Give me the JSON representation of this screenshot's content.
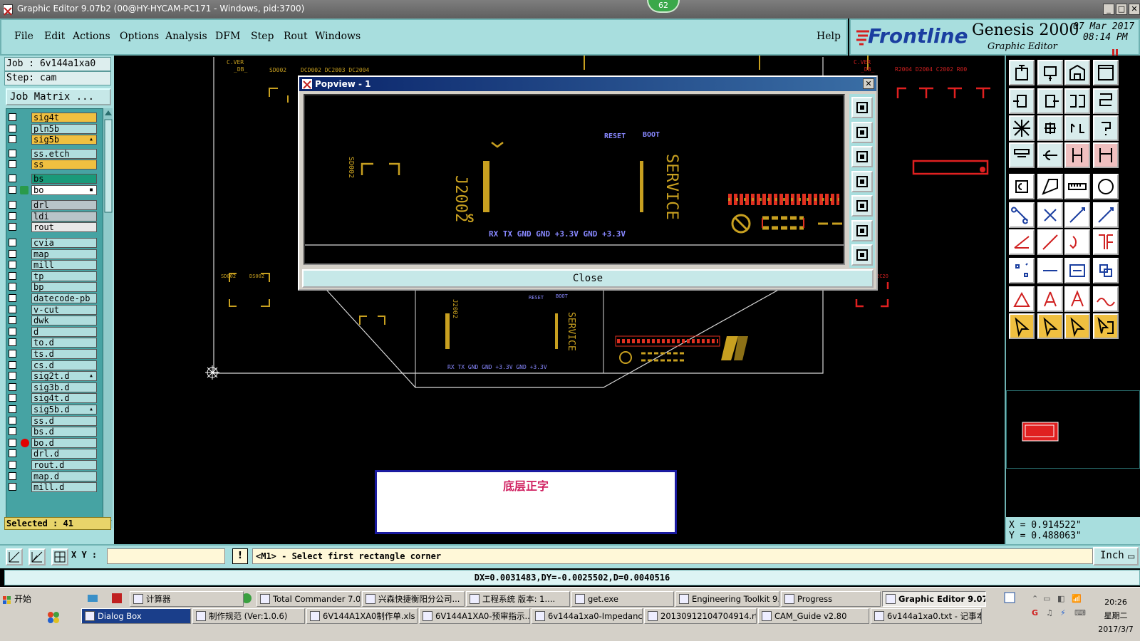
{
  "window": {
    "title": "Graphic Editor 9.07b2 (00@HY-HYCAM-PC171 - Windows, pid:3700)",
    "badge": "62",
    "controls": [
      "_",
      "□",
      "✕"
    ]
  },
  "menu": [
    "File",
    "Edit",
    "Actions",
    "Options",
    "Analysis",
    "DFM",
    "Step",
    "Rout",
    "Windows"
  ],
  "help": "Help",
  "brand": {
    "logo": "Frontline",
    "product": "Genesis 2000",
    "subtitle": "Graphic Editor",
    "date": "07 Mar 2017",
    "time": "08:14 PM"
  },
  "job": {
    "job_label": "Job : 6v144a1xa0",
    "step_label": "Step: cam",
    "matrix_button": "Job Matrix ..."
  },
  "layers": [
    {
      "name": "sig4t",
      "color": "#f0c040"
    },
    {
      "name": "pln5b",
      "color": "#b0dede"
    },
    {
      "name": "sig5b",
      "color": "#f0c040",
      "mark": "▴"
    },
    {
      "name": "ss.etch",
      "color": "#b0dede"
    },
    {
      "name": "ss",
      "color": "#f0c040"
    },
    {
      "name": "bs",
      "color": "#1a9a7a"
    },
    {
      "name": "bo",
      "color": "#ffffff",
      "mark": "▪"
    },
    {
      "name": "drl",
      "color": "#b8c4c8"
    },
    {
      "name": "ldi",
      "color": "#b8c4c8"
    },
    {
      "name": "rout",
      "color": "#e8e8e8"
    },
    {
      "name": "cvia",
      "color": "#b0dede"
    },
    {
      "name": "map",
      "color": "#b0dede"
    },
    {
      "name": "mill",
      "color": "#b0dede"
    },
    {
      "name": "tp",
      "color": "#b0dede"
    },
    {
      "name": "bp",
      "color": "#b0dede"
    },
    {
      "name": "datecode-pb",
      "color": "#b0dede"
    },
    {
      "name": "v-cut",
      "color": "#b0dede"
    },
    {
      "name": "dwk",
      "color": "#b0dede"
    },
    {
      "name": "d",
      "color": "#b0dede"
    },
    {
      "name": "to.d",
      "color": "#b0dede"
    },
    {
      "name": "ts.d",
      "color": "#b0dede"
    },
    {
      "name": "cs.d",
      "color": "#b0dede"
    },
    {
      "name": "sig2t.d",
      "color": "#b0dede",
      "mark": "▴"
    },
    {
      "name": "sig3b.d",
      "color": "#b0dede"
    },
    {
      "name": "sig4t.d",
      "color": "#b0dede"
    },
    {
      "name": "sig5b.d",
      "color": "#b0dede",
      "mark": "▴"
    },
    {
      "name": "ss.d",
      "color": "#b0dede"
    },
    {
      "name": "bs.d",
      "color": "#b0dede"
    },
    {
      "name": "bo.d",
      "color": "#b0dede",
      "dot": true
    },
    {
      "name": "drl.d",
      "color": "#b0dede"
    },
    {
      "name": "rout.d",
      "color": "#b0dede"
    },
    {
      "name": "map.d",
      "color": "#b0dede"
    },
    {
      "name": "mill.d",
      "color": "#b0dede"
    }
  ],
  "selected": "Selected : 41",
  "popview": {
    "title": "Popview - 1",
    "close_label": "Close",
    "labels": {
      "reset": "RESET",
      "boot": "BOOT",
      "service": "SERVICE",
      "j2002": "J2002",
      "pins": "RX  TX  GND  GND +3.3V  GND   +3.3V"
    }
  },
  "canvas": {
    "pins": "RX  TX  GND  GND +3.3V GND  +3.3V",
    "service": "SERVICE",
    "note_text": "底层正字"
  },
  "coords": {
    "x": "X = 0.914522\"",
    "y": "Y = 0.488063\""
  },
  "command": {
    "xy_label": "X Y :",
    "xy_value": "",
    "prompt": "<M1> - Select first rectangle corner",
    "units": "Inch"
  },
  "measure": "DX=0.0031483,DY=-0.0025502,D=0.0040516",
  "taskbar": {
    "start": "开始",
    "row1": [
      "计算器",
      "Total Commander 7.0 ...",
      "兴森快捷衡阳分公司...",
      "工程系统  版本: 1....",
      "get.exe",
      "Engineering Toolkit 9....",
      "Progress",
      "Graphic Editor 9.07..."
    ],
    "row2": [
      "Dialog Box",
      "制作规范 (Ver:1.0.6)",
      "6V144A1XA0制作单.xls ...",
      "6V144A1XA0-预审指示....",
      "6v144a1xa0-Impedance ...",
      "20130912104704914.rtf...",
      "CAM_Guide v2.80",
      "6v144a1xa0.txt - 记事本"
    ],
    "time": "20:26",
    "weekday": "星期二",
    "date": "2017/3/7"
  }
}
